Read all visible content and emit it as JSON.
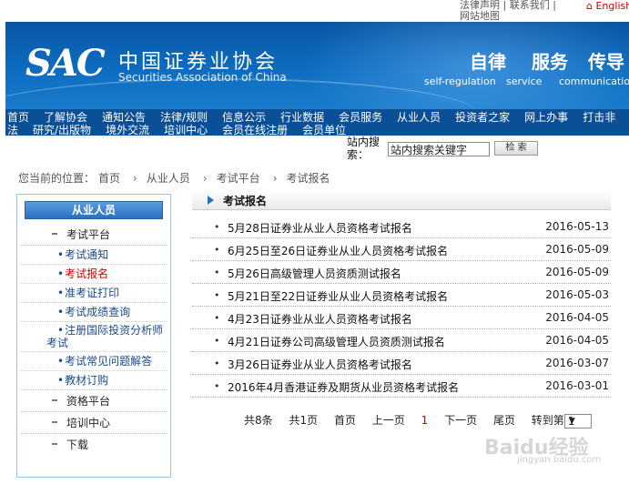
{
  "top_links": {
    "line1": "法律声明  |  联系我们  |",
    "line2": "网站地图",
    "english": "English"
  },
  "banner": {
    "logo_abbr": "SAC",
    "logo_cn": "中国证券业协会",
    "logo_en": "Securities Association of China",
    "slogans": [
      {
        "cn": "自律",
        "en": "self-regulation"
      },
      {
        "cn": "服务",
        "en": "service"
      },
      {
        "cn": "传导",
        "en": "communication"
      }
    ]
  },
  "nav": {
    "row1": [
      "首页",
      "了解协会",
      "通知公告",
      "法律/规则",
      "信息公示",
      "行业数据",
      "会员服务",
      "从业人员",
      "投资者之家",
      "网上办事",
      "打击非"
    ],
    "row2": [
      "法",
      "研究/出版物",
      "境外交流",
      "培训中心",
      "会员在线注册",
      "会员单位"
    ]
  },
  "search": {
    "label": "站内搜索：",
    "value": "站内搜索关键字",
    "button": "检 索"
  },
  "breadcrumb": {
    "prefix": "您当前的位置：",
    "items": [
      "首页",
      "从业人员",
      "考试平台",
      "考试报名"
    ]
  },
  "sidebar": {
    "title": "从业人员",
    "section1": "考试平台",
    "subitems": [
      "考试通知",
      "考试报名",
      "准考证打印",
      "考试成绩查询",
      "注册国际投资分析师考试",
      "考试常见问题解答",
      "教材订购"
    ],
    "sections": [
      "资格平台",
      "培训中心",
      "下载"
    ]
  },
  "content": {
    "title": "考试报名",
    "rows": [
      {
        "title": "5月28日证券业从业人员资格考试报名",
        "date": "2016-05-13"
      },
      {
        "title": "6月25日至26日证券业从业人员资格考试报名",
        "date": "2016-05-09"
      },
      {
        "title": "5月26日高级管理人员资质测试报名",
        "date": "2016-05-09"
      },
      {
        "title": "5月21日至22日证券业从业人员资格考试报名",
        "date": "2016-05-03"
      },
      {
        "title": "4月23日证券业从业人员资格考试报名",
        "date": "2016-04-05"
      },
      {
        "title": "4月21日证券公司高级管理人员资质测试报名",
        "date": "2016-04-05"
      },
      {
        "title": "3月26日证券业从业人员资格考试报名",
        "date": "2016-03-07"
      },
      {
        "title": "2016年4月香港证券及期货从业员资格考试报名",
        "date": "2016-03-01"
      }
    ]
  },
  "pager": {
    "total": "共8条",
    "pages": "共1页",
    "first": "首页",
    "prev": "上一页",
    "current": "1",
    "next": "下一页",
    "last": "尾页",
    "goto": "转到第",
    "selected": "1"
  },
  "watermark": {
    "text": "Baidu经验",
    "url": "jingyan.baidu.com"
  }
}
